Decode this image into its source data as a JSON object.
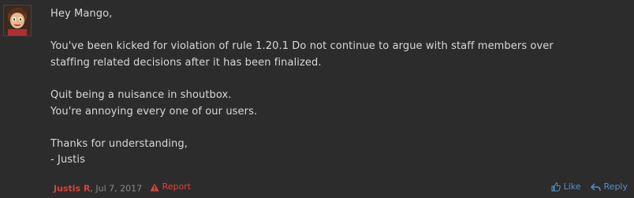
{
  "message": {
    "lines": [
      "Hey Mango,",
      "",
      "You've been kicked for violation of rule 1.20.1 Do not continue to argue with staff members over",
      "staffing related decisions after it has been finalized.",
      "",
      "Quit being a nuisance in shoutbox.",
      "You're annoying every one of our users.",
      "",
      "Thanks for understanding,",
      "- Justis"
    ]
  },
  "footer": {
    "author": "Justis R",
    "separator": ",",
    "date": "Jul 7, 2017",
    "report_label": "Report",
    "like_label": "Like",
    "reply_label": "Reply"
  },
  "colors": {
    "background": "#2c2c2c",
    "text": "#d8d8d8",
    "author": "#e0403a",
    "date": "#8a8a8a",
    "action": "#5a8fc8"
  }
}
